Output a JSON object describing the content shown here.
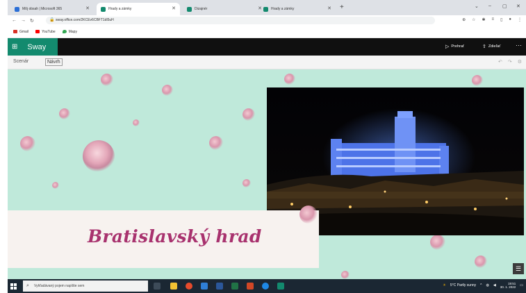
{
  "browser": {
    "tabs": [
      {
        "label": "Môj obsah | Microsoft 365",
        "favicon_color": "#2b6fd6"
      },
      {
        "label": "Hrady a zámky",
        "favicon_color": "#138a6e"
      },
      {
        "label": "Dizajnér",
        "favicon_color": "#138a6e"
      },
      {
        "label": "Hrady a zámky",
        "favicon_color": "#138a6e"
      }
    ],
    "url": "sway.office.com/2KCEv6CBFT1dl5uH",
    "bookmarks": [
      {
        "label": "Gmail",
        "color": "#d93025"
      },
      {
        "label": "YouTube",
        "color": "#ff0000"
      },
      {
        "label": "Mapy",
        "color": "#34a853"
      }
    ]
  },
  "sway": {
    "app_name": "Sway",
    "actions": {
      "play": "Prehrať",
      "share": "Zdieľať"
    },
    "subtabs": {
      "storyline": "Scenár",
      "design": "Návrh"
    }
  },
  "card": {
    "title": "Bratislavský hrad",
    "image_icon": "bratislava-castle-night-photo"
  },
  "taskbar": {
    "search_placeholder": "Vyhľadávaný pojem napíšte sem",
    "weather": "5°C Partly sunny",
    "time": "19:51",
    "date": "30. 1. 2022"
  },
  "colors": {
    "accent": "#138a6e",
    "title": "#a8326e",
    "canvas": "#bfe9da"
  }
}
